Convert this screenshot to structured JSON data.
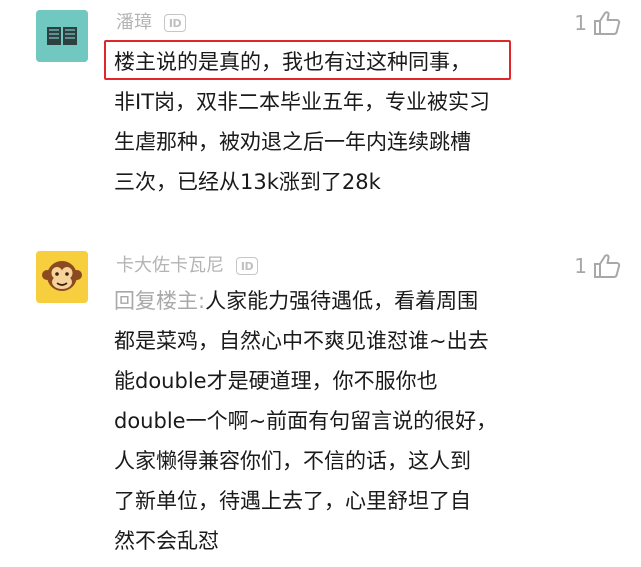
{
  "comments": [
    {
      "username": "潘璋",
      "id_badge": "ID",
      "like_count": "1",
      "avatar_icon": "book-icon",
      "lines": [
        "楼主说的是真的，我也有过这种同事，",
        "非IT岗，双非二本毕业五年，专业被实习",
        "生虐那种，被劝退之后一年内连续跳槽",
        "三次，已经从13k涨到了28k"
      ]
    },
    {
      "username": "卡大佐卡瓦尼",
      "id_badge": "ID",
      "like_count": "1",
      "avatar_icon": "monkey-face-icon",
      "reply_prefix": "回复楼主:",
      "first_line_rest": "人家能力强待遇低，看着周围",
      "lines": [
        "都是菜鸡，自然心中不爽见谁怼谁~出去",
        "能double才是硬道理，你不服你也",
        "double一个啊~前面有句留言说的很好，",
        "人家懒得兼容你们，不信的话，这人到",
        "了新单位，待遇上去了，心里舒坦了自",
        "然不会乱怼"
      ]
    }
  ],
  "colors": {
    "highlight_border": "#e0262a",
    "username": "#b4b4b4",
    "reply_prefix": "#a9a9a9",
    "avatar1_bg": "#71c8c1",
    "avatar2_bg": "#f7cf3e"
  }
}
